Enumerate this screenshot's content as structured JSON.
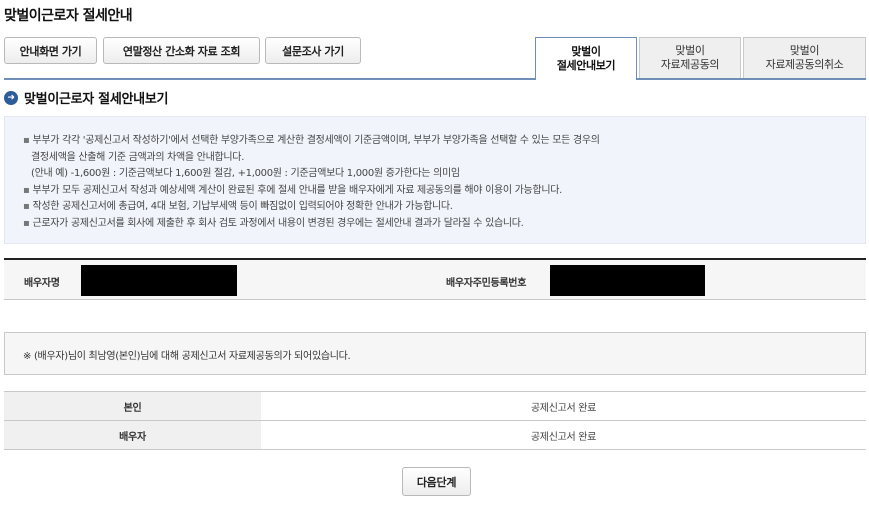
{
  "page_title": "맞벌이근로자 절세안내",
  "toolbar": {
    "home_label": "안내화면 가기",
    "simple_label": "연말정산 간소화 자료 조회",
    "survey_label": "설문조사 가기"
  },
  "tabs": [
    {
      "line1": "맞벌이",
      "line2": "절세안내보기",
      "active": true
    },
    {
      "line1": "맞벌이",
      "line2": "자료제공동의",
      "active": false
    },
    {
      "line1": "맞벌이",
      "line2": "자료제공동의취소",
      "active": false
    }
  ],
  "section": {
    "title": "맞벌이근로자 절세안내보기",
    "icon": "arrow-right-circle-icon"
  },
  "info": {
    "lines": [
      "부부가 각각 '공제신고서 작성하기'에서 선택한 부양가족으로 계산한 결정세액이 기준금액이며, 부부가 부양가족을 선택할 수 있는 모든 경우의",
      "결정세액을 산출해 기준 금액과의 차액을 안내합니다.",
      "(안내 예) -1,600원 : 기준금액보다 1,600원 절감, +1,000원 : 기준금액보다 1,000원 증가한다는 의미임",
      "부부가 모두 공제신고서 작성과 예상세액 계산이 완료된 후에 절세 안내를 받을 배우자에게 자료 제공동의를 해야 이용이 가능합니다.",
      "작성한 공제신고서에 총급여, 4대 보험, 기납부세액 등이 빠짐없이 입력되어야 정확한 안내가 가능합니다.",
      "근로자가 공제신고서를 회사에 제출한 후 회사 검토 과정에서 내용이 변경된 경우에는 절세안내 결과가 달라질 수 있습니다."
    ]
  },
  "spouse": {
    "name_label": "배우자명",
    "id_label": "배우자주민등록번호"
  },
  "notice": "※ (배우자)님이 최남영(본인)님에 대해 공제신고서 자료제공동의가 되어있습니다.",
  "status": [
    {
      "label": "본인",
      "value": "공제신고서 완료"
    },
    {
      "label": "배우자",
      "value": "공제신고서 완료"
    }
  ],
  "next_label": "다음단계"
}
